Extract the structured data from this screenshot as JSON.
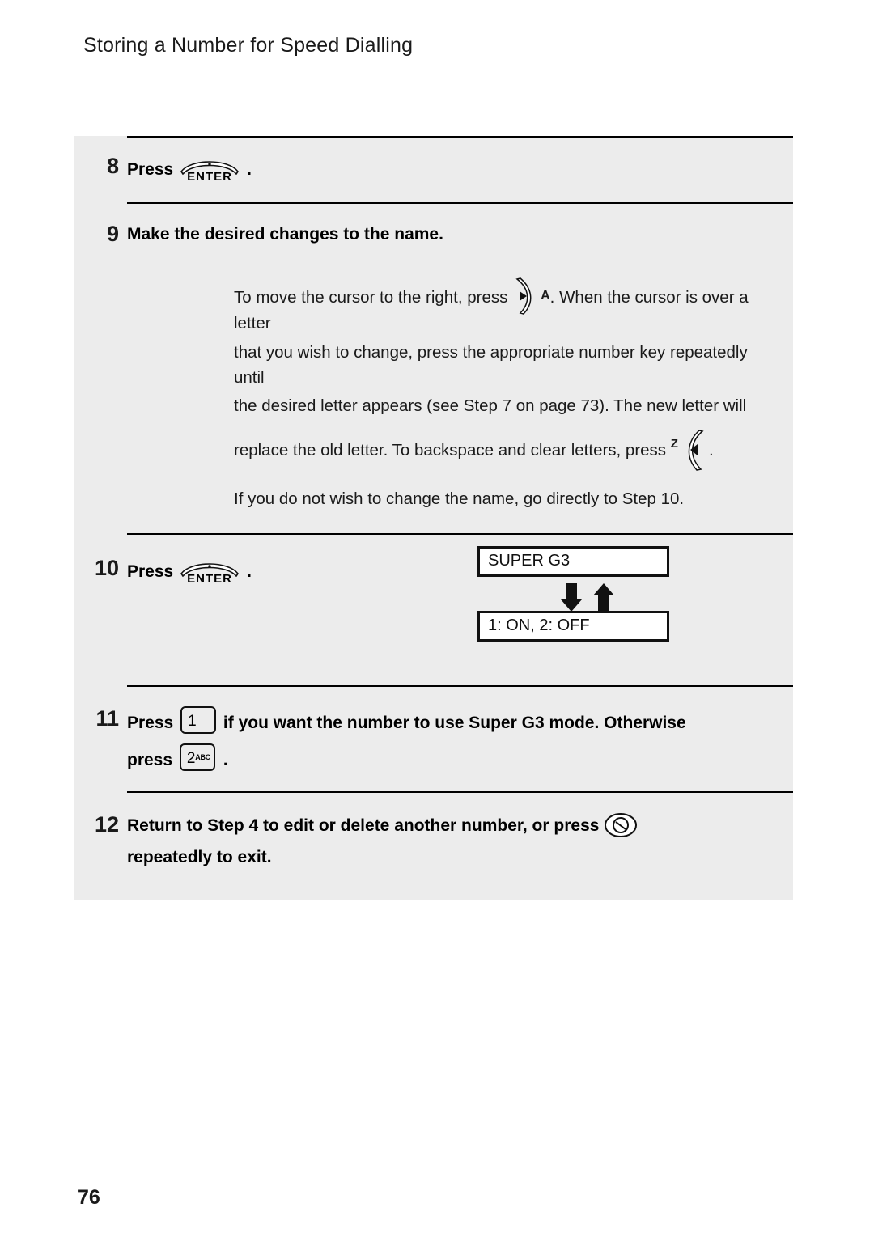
{
  "header": {
    "title": "Storing a Number for Speed Dialling"
  },
  "steps": {
    "s8": {
      "num": "8",
      "press_label": "Press",
      "key": "ENTER",
      "period": "."
    },
    "s9": {
      "num": "9",
      "heading": "Make the desired changes to the name.",
      "p1_a": "To move the cursor to the right, press",
      "p1_key_letter": "A",
      "p1_b": ". When the cursor is over a letter",
      "p2": "that you wish to change, press the appropriate number key repeatedly until",
      "p3": "the desired letter appears (see Step 7 on page 73). The new letter will",
      "p4_a": "replace the old letter. To backspace and clear letters, press",
      "p4_key_letter": "Z",
      "p4_b": ".",
      "p5": "If you do not wish to change the name, go directly to Step 10."
    },
    "s10": {
      "num": "10",
      "press_label": "Press",
      "key": "ENTER",
      "period": ".",
      "lcd_top": "SUPER G3",
      "lcd_bottom": "1: ON, 2: OFF"
    },
    "s11": {
      "num": "11",
      "press_label": "Press",
      "key1_digit": "1",
      "key1_sub": "",
      "text_a": "if you want the number to use Super G3 mode. Otherwise",
      "text_b": "press",
      "key2_digit": "2",
      "key2_sub": "ABC",
      "period": "."
    },
    "s12": {
      "num": "12",
      "text_a": "Return to Step 4 to edit or delete another number, or press",
      "text_b": "repeatedly to exit."
    }
  },
  "footer": {
    "page_number": "76"
  }
}
